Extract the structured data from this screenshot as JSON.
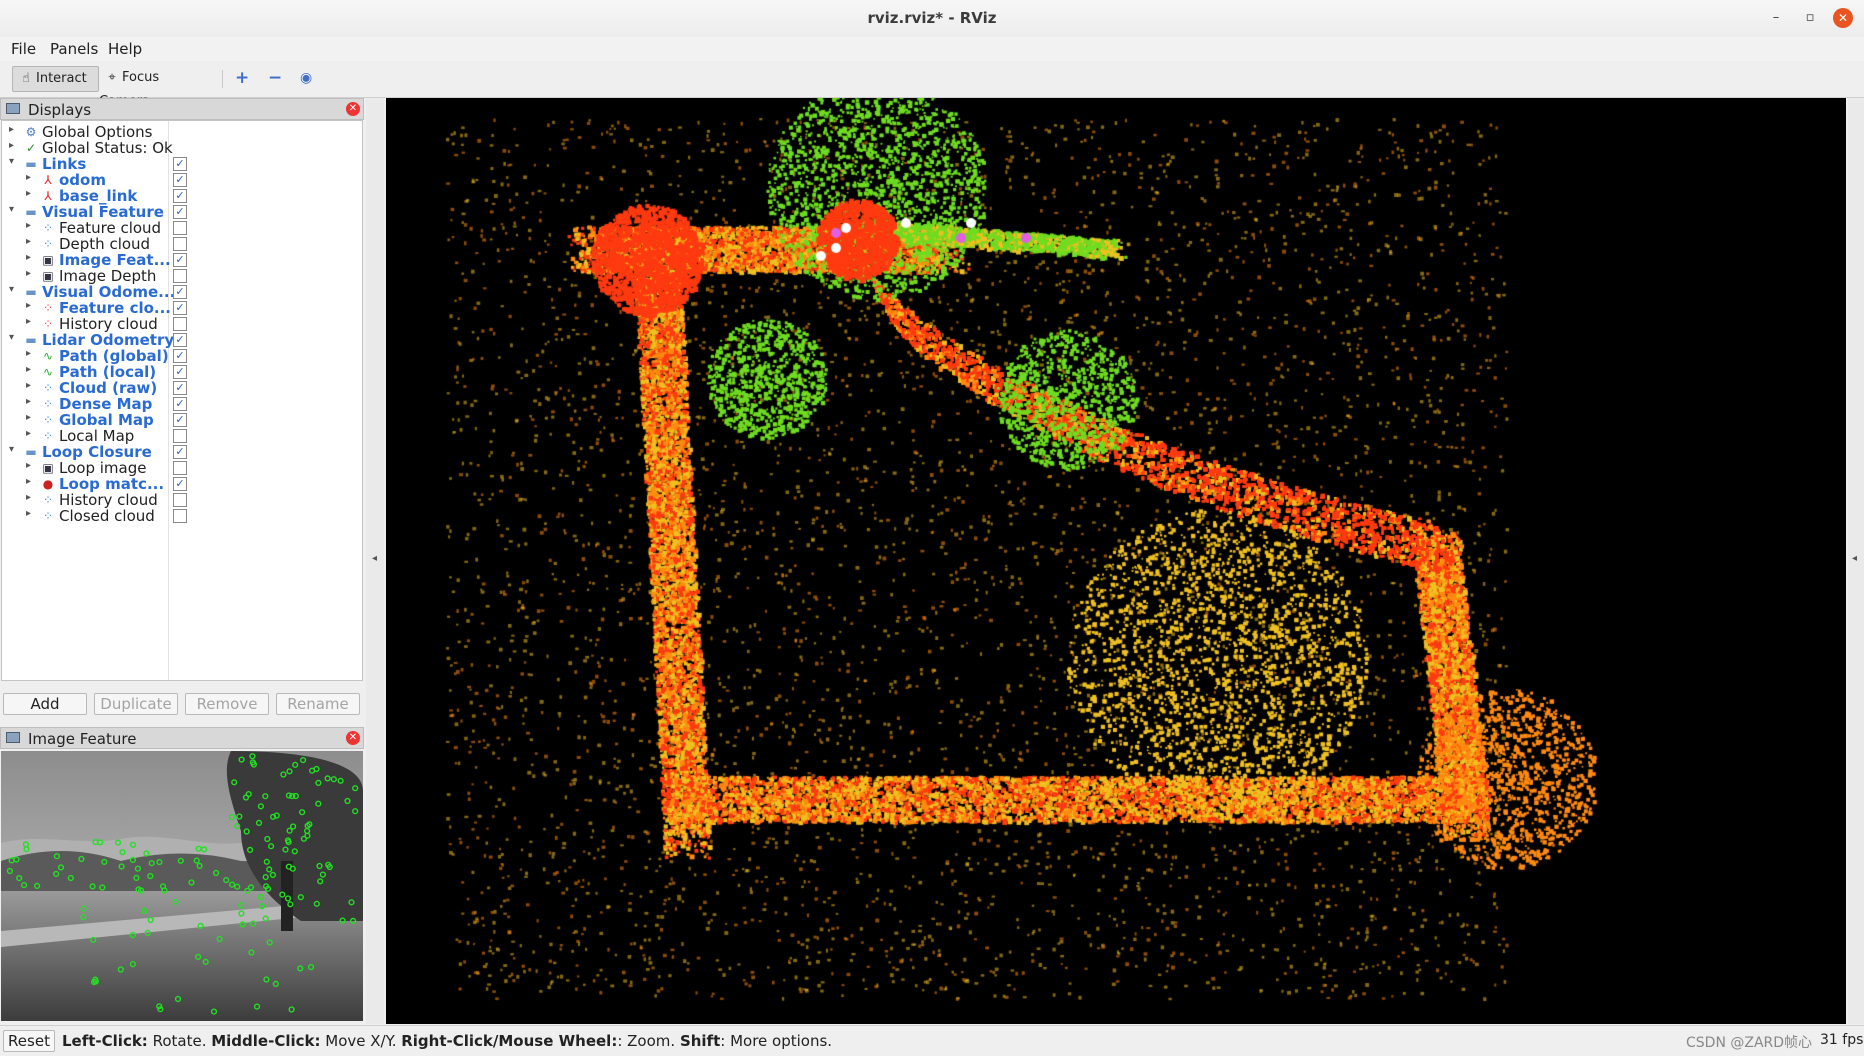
{
  "window": {
    "title": "rviz.rviz* - RViz",
    "minimize": "–",
    "maximize": "▫",
    "close": "✕"
  },
  "menu": {
    "file": "File",
    "panels": "Panels",
    "help": "Help"
  },
  "toolbar": {
    "interact": "Interact",
    "focus_camera": "Focus Camera",
    "add_icon": "plus-icon",
    "remove_icon": "minus-icon",
    "view_icon": "eye-icon"
  },
  "displays_panel": {
    "title": "Displays"
  },
  "tree": [
    {
      "label": "Global Options",
      "depth": 0,
      "icon": "gear-icon",
      "checked": null,
      "enabled": false
    },
    {
      "label": "Global Status: Ok",
      "depth": 0,
      "icon": "check-icon",
      "checked": null,
      "enabled": false
    },
    {
      "label": "Links",
      "depth": 0,
      "icon": "folder-icon",
      "checked": true,
      "enabled": true,
      "expanded": true
    },
    {
      "label": "odom",
      "depth": 1,
      "icon": "axes-icon",
      "checked": true,
      "enabled": true
    },
    {
      "label": "base_link",
      "depth": 1,
      "icon": "axes-icon",
      "checked": true,
      "enabled": true
    },
    {
      "label": "Visual Feature",
      "depth": 0,
      "icon": "folder-icon",
      "checked": true,
      "enabled": true,
      "expanded": true
    },
    {
      "label": "Feature cloud",
      "depth": 1,
      "icon": "cloud-icon",
      "checked": false,
      "enabled": false
    },
    {
      "label": "Depth cloud",
      "depth": 1,
      "icon": "cloud-icon",
      "checked": false,
      "enabled": false
    },
    {
      "label": "Image Feat...",
      "depth": 1,
      "icon": "image-icon",
      "checked": true,
      "enabled": true
    },
    {
      "label": "Image Depth",
      "depth": 1,
      "icon": "image-icon",
      "checked": false,
      "enabled": false
    },
    {
      "label": "Visual Odome...",
      "depth": 0,
      "icon": "folder-icon",
      "checked": true,
      "enabled": true,
      "expanded": true
    },
    {
      "label": "Feature clo...",
      "depth": 1,
      "icon": "cloud-red-icon",
      "checked": true,
      "enabled": true
    },
    {
      "label": "History cloud",
      "depth": 1,
      "icon": "cloud-red-icon",
      "checked": false,
      "enabled": false
    },
    {
      "label": "Lidar Odometry",
      "depth": 0,
      "icon": "folder-icon",
      "checked": true,
      "enabled": true,
      "expanded": true
    },
    {
      "label": "Path (global)",
      "depth": 1,
      "icon": "path-icon",
      "checked": true,
      "enabled": true
    },
    {
      "label": "Path (local)",
      "depth": 1,
      "icon": "path-icon",
      "checked": true,
      "enabled": true
    },
    {
      "label": "Cloud (raw)",
      "depth": 1,
      "icon": "cloud-icon",
      "checked": true,
      "enabled": true
    },
    {
      "label": "Dense Map",
      "depth": 1,
      "icon": "cloud-icon",
      "checked": true,
      "enabled": true
    },
    {
      "label": "Global Map",
      "depth": 1,
      "icon": "cloud-icon",
      "checked": true,
      "enabled": true
    },
    {
      "label": "Local Map",
      "depth": 1,
      "icon": "cloud-icon",
      "checked": false,
      "enabled": false
    },
    {
      "label": "Loop Closure",
      "depth": 0,
      "icon": "folder-icon",
      "checked": true,
      "enabled": true,
      "expanded": true
    },
    {
      "label": "Loop image",
      "depth": 1,
      "icon": "image-icon",
      "checked": false,
      "enabled": false
    },
    {
      "label": "Loop matc...",
      "depth": 1,
      "icon": "markers-icon",
      "checked": true,
      "enabled": true
    },
    {
      "label": "History cloud",
      "depth": 1,
      "icon": "cloud-icon",
      "checked": false,
      "enabled": false
    },
    {
      "label": "Closed cloud",
      "depth": 1,
      "icon": "cloud-icon",
      "checked": false,
      "enabled": false
    }
  ],
  "panel_buttons": {
    "add": "Add",
    "duplicate": "Duplicate",
    "remove": "Remove",
    "rename": "Rename"
  },
  "image_panel": {
    "title": "Image Feature"
  },
  "statusbar": {
    "reset": "Reset",
    "hint_left_click": "Left-Click:",
    "hint_rotate": " Rotate. ",
    "hint_middle_click": "Middle-Click:",
    "hint_move": " Move X/Y. ",
    "hint_right_click": "Right-Click/Mouse Wheel:",
    "hint_zoom": ": Zoom. ",
    "hint_shift": "Shift",
    "hint_more": ": More options.",
    "fps": "31 fps",
    "watermark": "CSDN @ZARD帧心"
  },
  "colors": {
    "accent_blue": "#2a6bd1",
    "map_red": "#ff3a10",
    "map_orange": "#ff8a10",
    "map_yellow": "#f0c020",
    "map_green": "#6fdc20",
    "feature_green": "#22e022"
  }
}
